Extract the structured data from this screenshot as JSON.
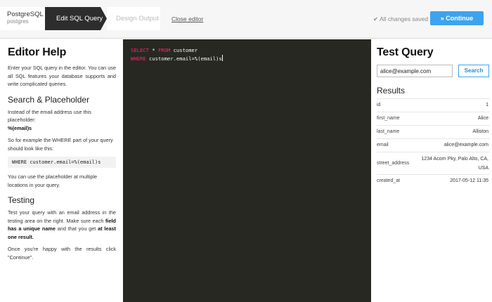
{
  "steps": {
    "database": {
      "title": "PostgreSQL",
      "subtitle": "postgres"
    },
    "active": "Edit SQL Query",
    "next": "Design Output"
  },
  "header": {
    "close_editor": "Close editor",
    "saved_status": "All changes saved",
    "continue_label": "Continue",
    "continue_icon": "double-chevron-right",
    "accent_color": "#3ea3ee"
  },
  "help": {
    "title": "Editor Help",
    "intro": "Enter your SQL query in the editor. You can use all SQL features your database supports and write complicated queries.",
    "placeholder_heading": "Search & Placeholder",
    "placeholder_text_1": "Instead of the email address use this placeholder:",
    "placeholder_token": "%(email)s",
    "placeholder_text_2": "So for example the WHERE part of your query should look like this:",
    "code_example": "WHERE customer.email=%(email)s",
    "placeholder_text_3": "You can use the placeholder at multiple locations in your query.",
    "testing_heading": "Testing",
    "testing_text_1a": "Test your query with an email address in the testing area on the right. Make sure each ",
    "testing_bold_1": "field has a unique name",
    "testing_text_1b": " and that you get ",
    "testing_bold_2": "at least one result.",
    "testing_text_2": "Once you're happy with the results click \"Continue\"."
  },
  "editor": {
    "line1_kw1": "SELECT",
    "line1_mid": " * ",
    "line1_kw2": "FROM",
    "line1_rest": " customer",
    "line2_kw": "WHERE",
    "line2_rest": " customer.email=%(email)s"
  },
  "test": {
    "title": "Test Query",
    "input_value": "alice@example.com",
    "search_label": "Search",
    "results_title": "Results",
    "rows": [
      {
        "key": "id",
        "value": "1"
      },
      {
        "key": "first_name",
        "value": "Alice"
      },
      {
        "key": "last_name",
        "value": "Alliston"
      },
      {
        "key": "email",
        "value": "alice@example.com"
      },
      {
        "key": "street_address",
        "value": "1234 Acorn Pky, Palo Alto, CA, USA"
      },
      {
        "key": "created_at",
        "value": "2017-05-12 11:35"
      }
    ]
  }
}
